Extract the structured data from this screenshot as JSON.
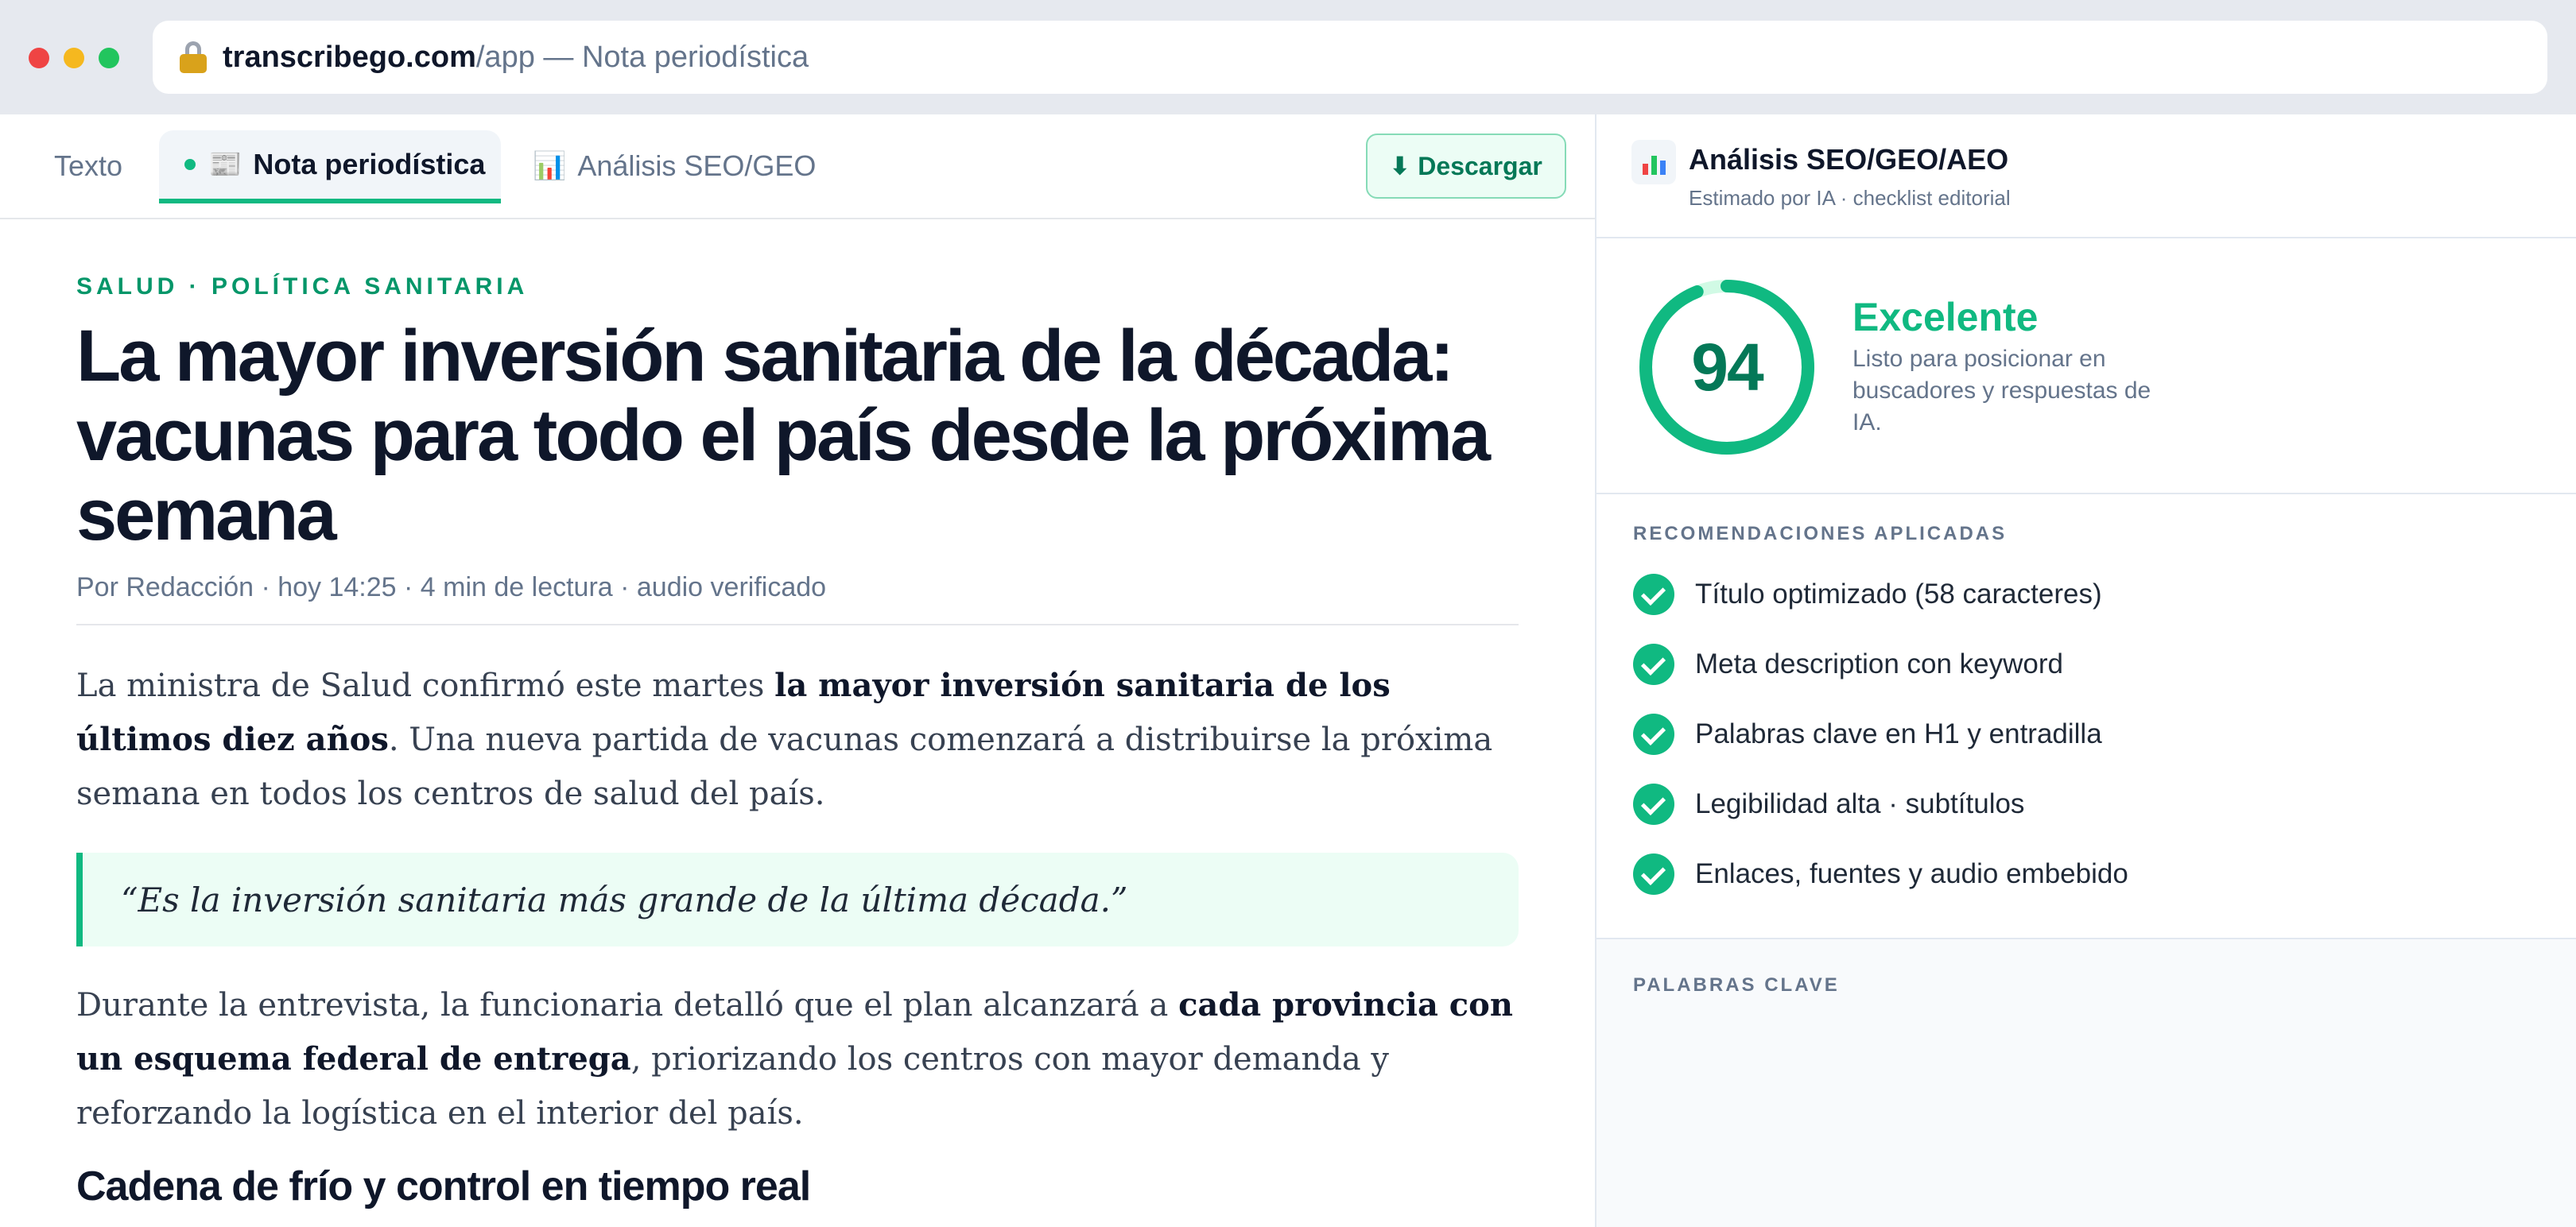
{
  "browser": {
    "url_host": "transcribego.com",
    "url_path": "/app — Nota periodística"
  },
  "tabs": [
    {
      "label": "Texto"
    },
    {
      "label": "Nota periodística",
      "icon": "📰"
    },
    {
      "label": "Análisis SEO/GEO",
      "icon": "📊"
    }
  ],
  "toolbar": {
    "download_label": "Descargar",
    "download_icon": "⬇"
  },
  "article": {
    "kicker": "SALUD · POLÍTICA SANITARIA",
    "headline": "La mayor inversión sanitaria de la década: vacunas para todo el país desde la próxima semana",
    "byline": "Por Redacción · hoy 14:25 · 4 min de lectura · audio verificado",
    "p1_a": "La ministra de Salud confirmó este martes ",
    "p1_b": "la mayor inversión sanitaria de los últimos diez años",
    "p1_c": ". Una nueva partida de vacunas comenzará a distribuirse la próxima semana en todos los centros de salud del país.",
    "quote": "“Es la inversión sanitaria más grande de la última década.”",
    "p2_a": "Durante la entrevista, la funcionaria detalló que el plan alcanzará a ",
    "p2_b": "cada provincia con un esquema federal de entrega",
    "p2_c": ", priorizando los centros con mayor demanda y reforzando la logística en el interior del país.",
    "subhead": "Cadena de frío y control en tiempo real"
  },
  "panel": {
    "title": "Análisis SEO/GEO/AEO",
    "subtitle": "Estimado por IA · checklist editorial",
    "score": "94",
    "score_fraction": 0.94,
    "score_label": "Excelente",
    "score_desc": "Listo para posicionar en buscadores y respuestas de IA.",
    "accent": "#10b981",
    "recs_label": "RECOMENDACIONES APLICADAS",
    "recs": [
      "Título optimizado (58 caracteres)",
      "Meta description con keyword",
      "Palabras clave en H1 y entradilla",
      "Legibilidad alta · subtítulos",
      "Enlaces, fuentes y audio embebido"
    ],
    "keywords_label": "PALABRAS CLAVE"
  }
}
